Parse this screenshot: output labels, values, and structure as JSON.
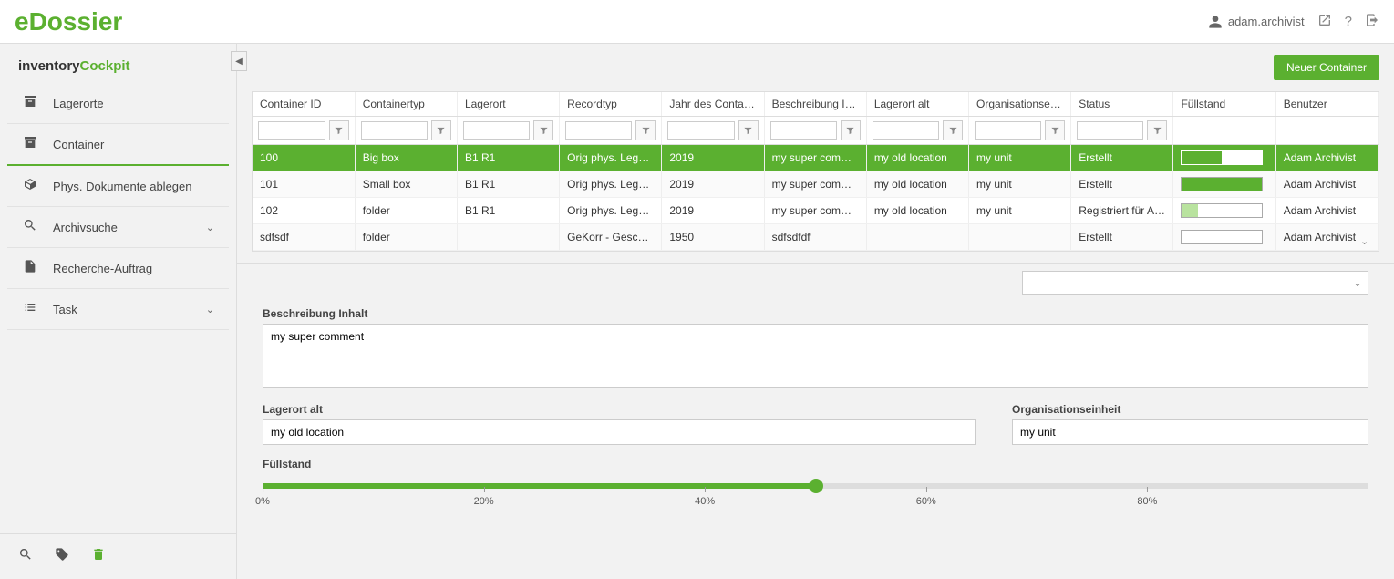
{
  "app": {
    "logo_prefix": "e",
    "logo_text": "Dossier"
  },
  "header": {
    "username": "adam.archivist"
  },
  "sidebar": {
    "title_a": "inventory",
    "title_b": "Cockpit",
    "items": [
      {
        "label": "Lagerorte",
        "icon": "archive"
      },
      {
        "label": "Container",
        "icon": "archive",
        "active": true
      },
      {
        "label": "Phys. Dokumente ablegen",
        "icon": "box"
      },
      {
        "label": "Archivsuche",
        "icon": "search",
        "expandable": true
      },
      {
        "label": "Recherche-Auftrag",
        "icon": "file"
      },
      {
        "label": "Task",
        "icon": "list",
        "expandable": true
      }
    ]
  },
  "toolbar": {
    "new_container": "Neuer Container"
  },
  "grid": {
    "columns": [
      "Container ID",
      "Containertyp",
      "Lagerort",
      "Recordtyp",
      "Jahr des Contain...",
      "Beschreibung Inhalt",
      "Lagerort alt",
      "Organisationsein...",
      "Status",
      "Füllstand",
      "Benutzer"
    ],
    "rows": [
      {
        "id": "100",
        "typ": "Big box",
        "lagerort": "B1 R1",
        "recordtyp": "Orig phys. Legac...",
        "jahr": "2019",
        "beschreibung": "my super comment",
        "lagerort_alt": "my old location",
        "org": "my unit",
        "status": "Erstellt",
        "fill": 50,
        "user": "Adam Archivist",
        "selected": true
      },
      {
        "id": "101",
        "typ": "Small box",
        "lagerort": "B1 R1",
        "recordtyp": "Orig phys. Legac...",
        "jahr": "2019",
        "beschreibung": "my super comment",
        "lagerort_alt": "my old location",
        "org": "my unit",
        "status": "Erstellt",
        "fill": 100,
        "user": "Adam Archivist"
      },
      {
        "id": "102",
        "typ": "folder",
        "lagerort": "B1 R1",
        "recordtyp": "Orig phys. Legac...",
        "jahr": "2019",
        "beschreibung": "my super comment",
        "lagerort_alt": "my old location",
        "org": "my unit",
        "status": "Registriert für Archivier...",
        "fill": 20,
        "fill_low": true,
        "user": "Adam Archivist"
      },
      {
        "id": "sdfsdf",
        "typ": "folder",
        "lagerort": "",
        "recordtyp": "GeKorr - Geschä...",
        "jahr": "1950",
        "beschreibung": "sdfsdfdf",
        "lagerort_alt": "",
        "org": "",
        "status": "Erstellt",
        "fill": 0,
        "user": "Adam Archivist"
      }
    ]
  },
  "detail": {
    "beschreibung_label": "Beschreibung Inhalt",
    "beschreibung_value": "my super comment",
    "lagerort_alt_label": "Lagerort alt",
    "lagerort_alt_value": "my old location",
    "org_label": "Organisationseinheit",
    "org_value": "my unit",
    "fuellstand_label": "Füllstand",
    "fuellstand_value": 50,
    "ticks": [
      "0%",
      "20%",
      "40%",
      "60%",
      "80%"
    ]
  }
}
